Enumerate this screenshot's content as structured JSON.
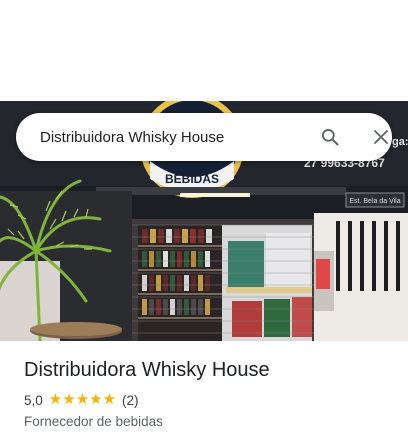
{
  "search": {
    "value": "Distribuidora Whisky House",
    "search_icon": "search-icon",
    "close_icon": "close-icon"
  },
  "photo": {
    "sign_text": "BEBIDAS",
    "phone_text": "27 99633-8767",
    "side_text": "ga:",
    "small_sign": "Est. Bela da Vila"
  },
  "place": {
    "name": "Distribuidora Whisky House",
    "rating": "5,0",
    "stars": 5,
    "review_count": "(2)",
    "category": "Fornecedor de bebidas"
  },
  "colors": {
    "star": "#f4b400",
    "text": "#202124",
    "muted": "#5f6368"
  }
}
